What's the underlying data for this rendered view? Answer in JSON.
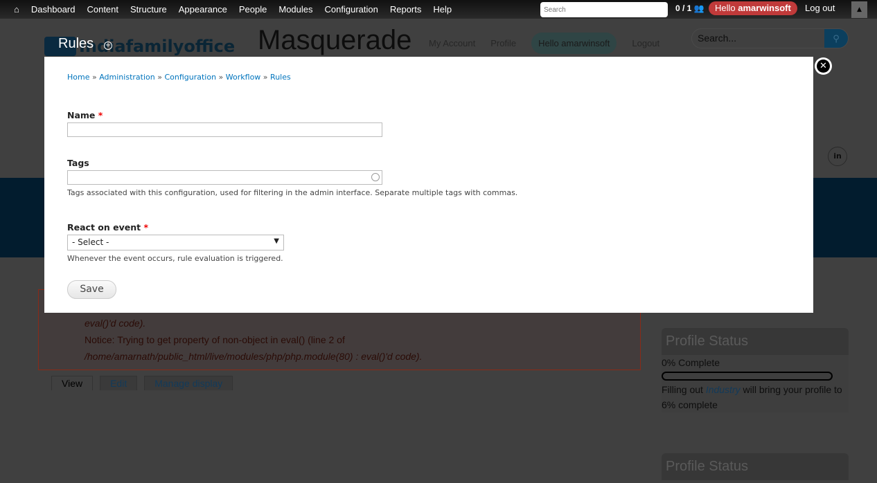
{
  "toolbar": {
    "items": [
      "Dashboard",
      "Content",
      "Structure",
      "Appearance",
      "People",
      "Modules",
      "Configuration",
      "Reports",
      "Help"
    ],
    "search_placeholder": "Search",
    "count": "0 / 1",
    "hello": "Hello",
    "username": "amarwinsoft",
    "logout": "Log out"
  },
  "site": {
    "logo_text": "Indiafamilyoffice",
    "name": "Masquerade",
    "user_nav": [
      "My Account",
      "Profile",
      "Hello amarwinsoft",
      "Logout"
    ],
    "search_placeholder": "Search...",
    "error_lines": [
      "eval()'d code).",
      "Notice: Trying to get property of non-object in eval() (line 2 of",
      "/home/amarnath/public_html/live/modules/php/php.module(80) : eval()'d code)."
    ],
    "tabs": [
      "View",
      "Edit",
      "Manage display"
    ],
    "profile_status": {
      "title": "Profile Status",
      "complete": "0% Complete",
      "progress_percent": 0,
      "hint_pre": "Filling out ",
      "hint_link": "Industry",
      "hint_post": " will bring your profile to 6% complete"
    }
  },
  "modal": {
    "title": "Rules",
    "breadcrumb": [
      "Home",
      "Administration",
      "Configuration",
      "Workflow",
      "Rules"
    ],
    "name_label": "Name",
    "name_value": "",
    "tags_label": "Tags",
    "tags_value": "",
    "tags_desc": "Tags associated with this configuration, used for filtering in the admin interface. Separate multiple tags with commas.",
    "event_label": "React on event",
    "event_value": "- Select -",
    "event_desc": "Whenever the event occurs, rule evaluation is triggered.",
    "required": "*",
    "save": "Save"
  },
  "colors": {
    "accent": "#0074bd",
    "hello_badge": "#c03a3a",
    "required": "#ee0000"
  }
}
